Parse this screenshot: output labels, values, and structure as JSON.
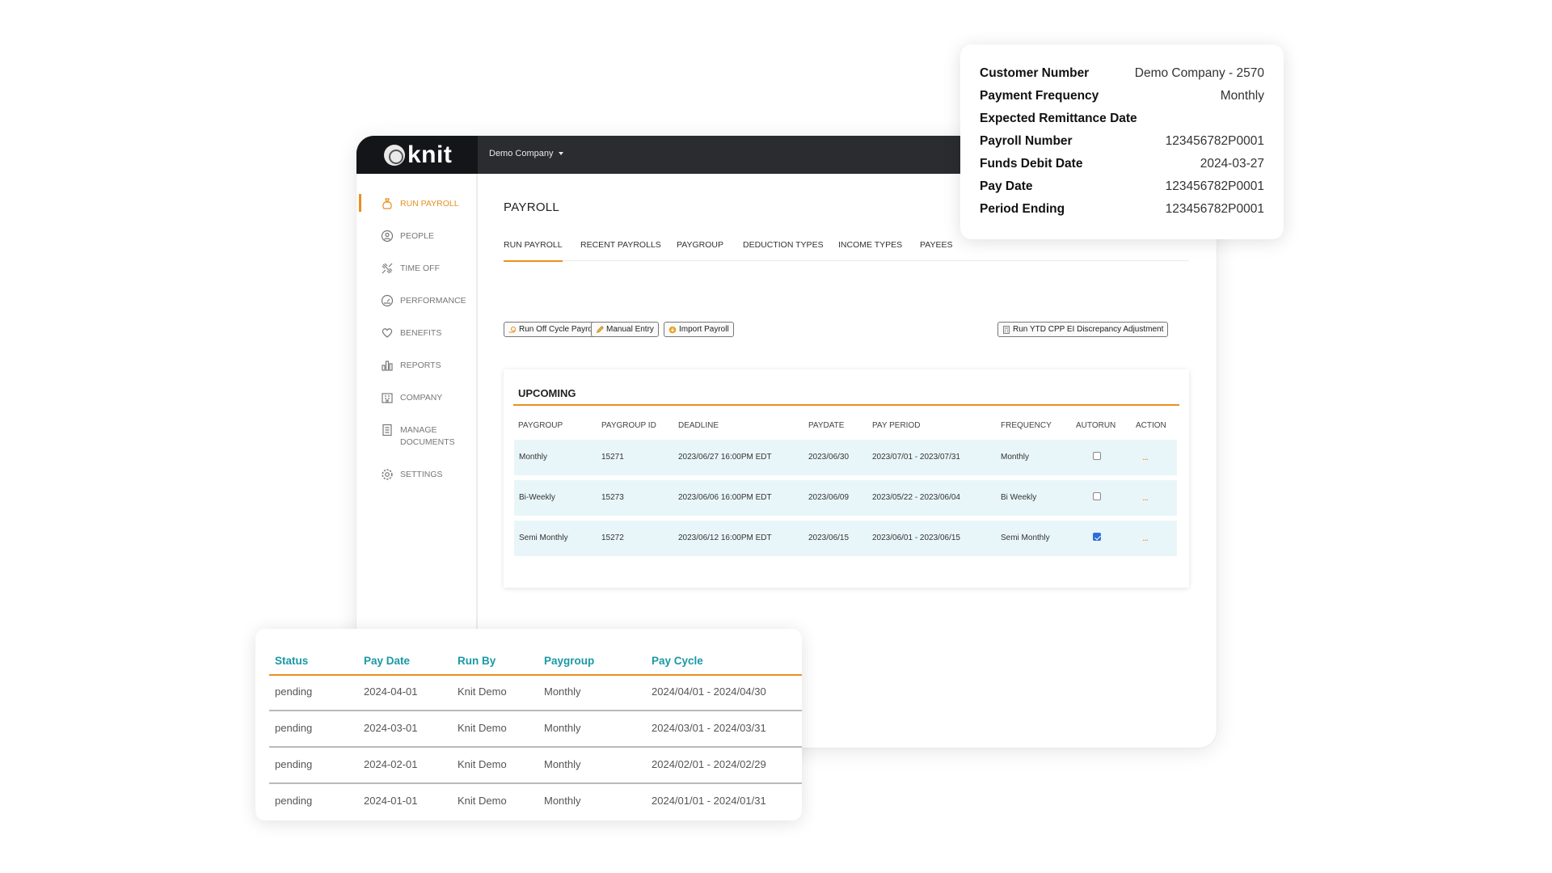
{
  "app": {
    "logo_text": "knit",
    "company_selector": "Demo Company"
  },
  "sidebar": {
    "items": [
      {
        "label": "RUN PAYROLL",
        "icon": "money-bag-icon"
      },
      {
        "label": "PEOPLE",
        "icon": "person-icon"
      },
      {
        "label": "TIME OFF",
        "icon": "plane-icon"
      },
      {
        "label": "PERFORMANCE",
        "icon": "gauge-icon"
      },
      {
        "label": "BENEFITS",
        "icon": "heart-hand-icon"
      },
      {
        "label": "REPORTS",
        "icon": "bar-chart-icon"
      },
      {
        "label": "COMPANY",
        "icon": "building-icon"
      },
      {
        "label": "MANAGE",
        "label2": "DOCUMENTS",
        "icon": "document-icon"
      },
      {
        "label": "SETTINGS",
        "icon": "gear-icon"
      }
    ]
  },
  "page": {
    "title": "PAYROLL",
    "tabs": [
      "RUN PAYROLL",
      "RECENT PAYROLLS",
      "PAYGROUP",
      "DEDUCTION TYPES",
      "INCOME TYPES",
      "PAYEES"
    ],
    "actions": {
      "off_cycle": "Run Off Cycle Payroll",
      "manual_entry": "Manual Entry",
      "import": "Import Payroll",
      "ytd_adjust": "Run YTD CPP EI Discrepancy Adjustment"
    }
  },
  "upcoming": {
    "title": "UPCOMING",
    "columns": [
      "PAYGROUP",
      "PAYGROUP ID",
      "DEADLINE",
      "PAYDATE",
      "PAY PERIOD",
      "FREQUENCY",
      "AUTORUN",
      "ACTION"
    ],
    "rows": [
      {
        "paygroup": "Monthly",
        "id": "15271",
        "deadline": "2023/06/27 16:00PM EDT",
        "paydate": "2023/06/30",
        "period": "2023/07/01 - 2023/07/31",
        "frequency": "Monthly",
        "autorun": false,
        "action": "..."
      },
      {
        "paygroup": "Bi-Weekly",
        "id": "15273",
        "deadline": "2023/06/06 16:00PM EDT",
        "paydate": "2023/06/09",
        "period": "2023/05/22 - 2023/06/04",
        "frequency": "Bi Weekly",
        "autorun": false,
        "action": "..."
      },
      {
        "paygroup": "Semi Monthly",
        "id": "15272",
        "deadline": "2023/06/12 16:00PM EDT",
        "paydate": "2023/06/15",
        "period": "2023/06/01 - 2023/06/15",
        "frequency": "Semi Monthly",
        "autorun": true,
        "action": "..."
      }
    ]
  },
  "info_card": {
    "rows": [
      {
        "label": "Customer Number",
        "value": "Demo Company - 2570"
      },
      {
        "label": "Payment Frequency",
        "value": "Monthly"
      },
      {
        "label": "Expected Remittance Date",
        "value": ""
      },
      {
        "label": "Payroll Number",
        "value": "123456782P0001"
      },
      {
        "label": "Funds Debit Date",
        "value": "2024-03-27"
      },
      {
        "label": "Pay Date",
        "value": "123456782P0001"
      },
      {
        "label": "Period Ending",
        "value": "123456782P0001"
      }
    ]
  },
  "history": {
    "columns": [
      "Status",
      "Pay Date",
      "Run By",
      "Paygroup",
      "Pay Cycle"
    ],
    "rows": [
      {
        "status": "pending",
        "pay_date": "2024-04-01",
        "run_by": "Knit Demo",
        "paygroup": "Monthly",
        "cycle": "2024/04/01 - 2024/04/30"
      },
      {
        "status": "pending",
        "pay_date": "2024-03-01",
        "run_by": "Knit Demo",
        "paygroup": "Monthly",
        "cycle": "2024/03/01 - 2024/03/31"
      },
      {
        "status": "pending",
        "pay_date": "2024-02-01",
        "run_by": "Knit Demo",
        "paygroup": "Monthly",
        "cycle": "2024/02/01 - 2024/02/29"
      },
      {
        "status": "pending",
        "pay_date": "2024-01-01",
        "run_by": "Knit Demo",
        "paygroup": "Monthly",
        "cycle": "2024/01/01 - 2024/01/31"
      }
    ]
  },
  "colors": {
    "accent": "#e8901f",
    "teal_header": "#1a98a5",
    "row_highlight": "#e9f6f9",
    "topbar": "#2a2c30"
  }
}
